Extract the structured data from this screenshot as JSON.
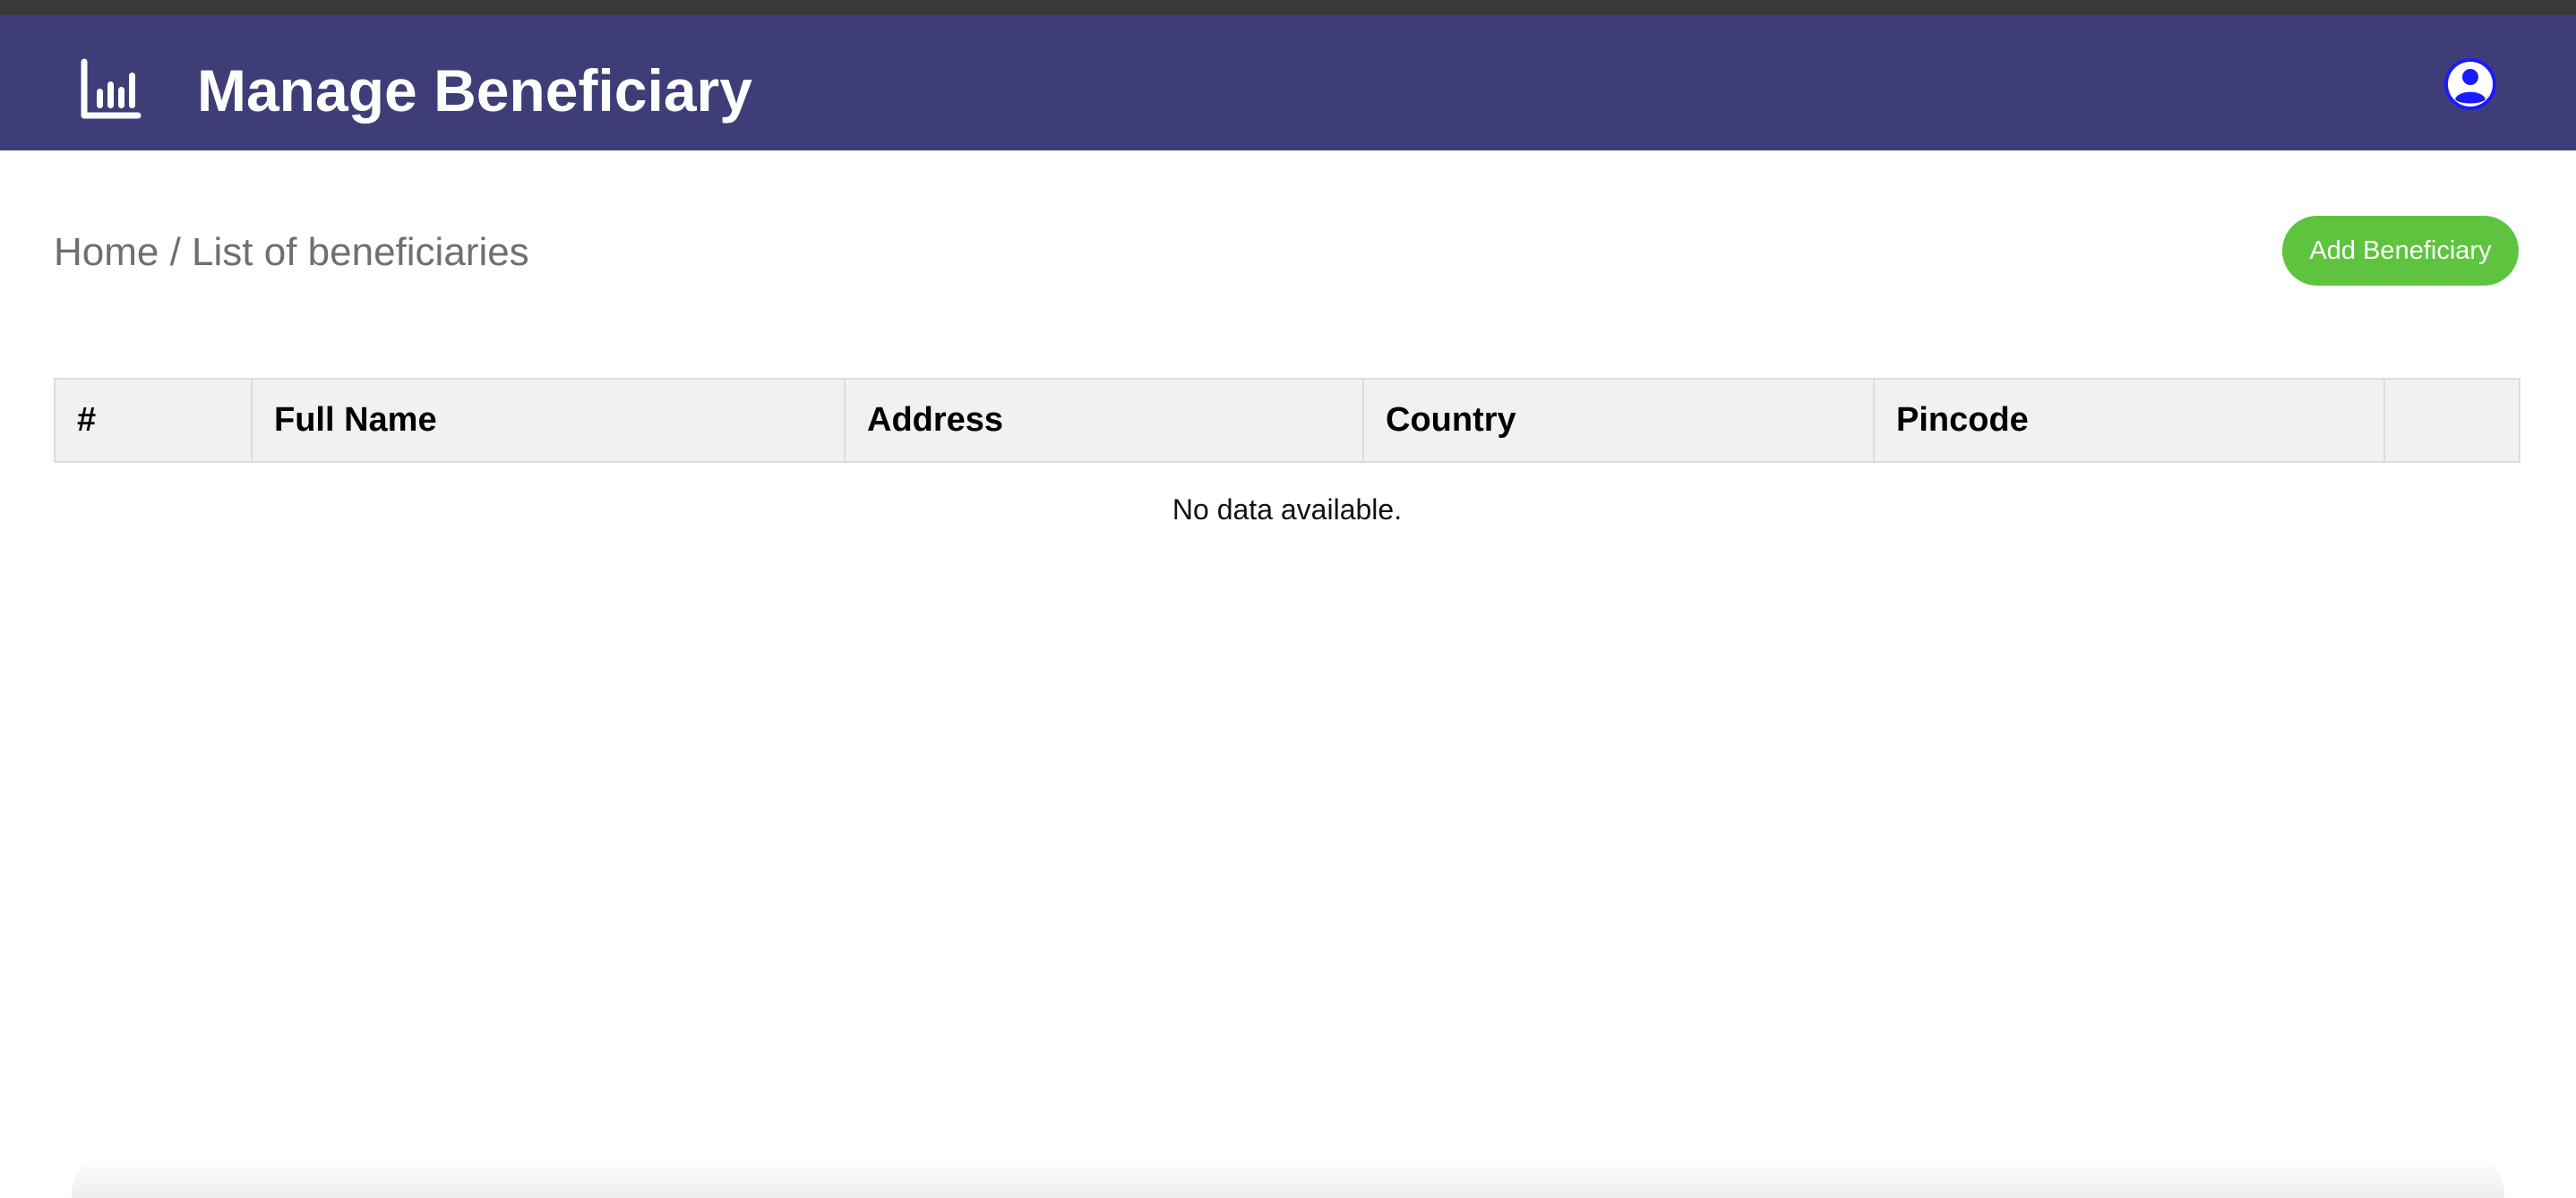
{
  "header": {
    "title": "Manage Beneficiary",
    "logo_icon": "bar-chart-icon",
    "profile_icon": "user-circle-icon",
    "background_color": "#3f3d78",
    "profile_icon_color": "#1a1aff"
  },
  "breadcrumb": {
    "text": "Home / List of beneficiaries"
  },
  "actions": {
    "add_label": "Add Beneficiary",
    "add_color": "#5ec43f"
  },
  "table": {
    "columns": [
      "#",
      "Full Name",
      "Address",
      "Country",
      "Pincode",
      ""
    ],
    "empty_message": "No data available."
  }
}
